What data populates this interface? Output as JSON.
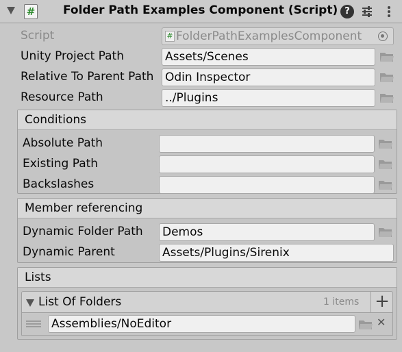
{
  "header": {
    "title": "Folder Path Examples Component (Script)",
    "script_icon_glyph": "#",
    "help_glyph": "?"
  },
  "script_row": {
    "label": "Script",
    "value": "FolderPathExamplesComponent"
  },
  "fields": {
    "unity_project_path": {
      "label": "Unity Project Path",
      "value": "Assets/Scenes"
    },
    "relative_to_parent_path": {
      "label": "Relative To Parent Path",
      "value": "Odin Inspector"
    },
    "resource_path": {
      "label": "Resource Path",
      "value": "../Plugins"
    }
  },
  "conditions": {
    "title": "Conditions",
    "absolute_path": {
      "label": "Absolute Path",
      "value": ""
    },
    "existing_path": {
      "label": "Existing Path",
      "value": ""
    },
    "backslashes": {
      "label": "Backslashes",
      "value": ""
    }
  },
  "member_referencing": {
    "title": "Member referencing",
    "dynamic_folder_path": {
      "label": "Dynamic Folder Path",
      "value": "Demos"
    },
    "dynamic_parent": {
      "label": "Dynamic Parent",
      "value": "Assets/Plugins/Sirenix"
    }
  },
  "lists": {
    "title": "Lists",
    "list_of_folders": {
      "label": "List Of Folders",
      "count_text": "1 items",
      "add_glyph": "+",
      "remove_glyph": "✕",
      "items": [
        "Assemblies/NoEditor"
      ]
    }
  },
  "icons": [
    "foldout-arrow-icon",
    "script-icon",
    "help-icon",
    "presets-icon",
    "menu-icon",
    "target-icon",
    "folder-icon",
    "drag-handle-icon",
    "add-icon",
    "remove-icon"
  ],
  "colors": {
    "background": "#c8c8c8",
    "field": "#f0f0f0",
    "box_header": "#d8d8d8"
  }
}
